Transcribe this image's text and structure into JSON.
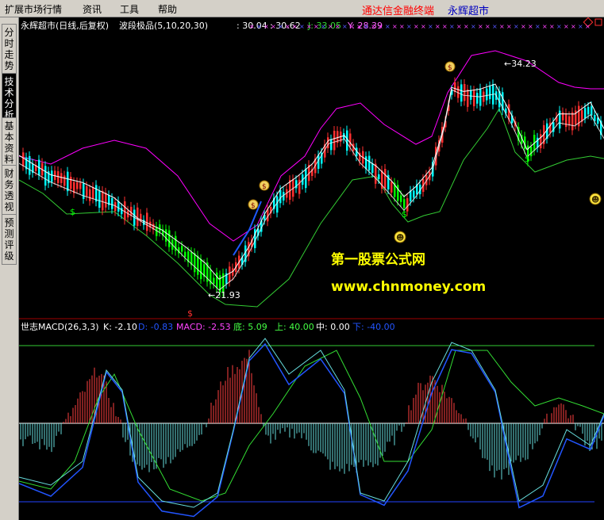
{
  "menu": {
    "items": [
      "扩展市场行情",
      "资讯",
      "工具",
      "帮助"
    ],
    "brand_left": "通达信金融终端",
    "brand_right": "永辉超市",
    "brand_left_color": "#ff0000",
    "brand_right_color": "#0000c0"
  },
  "sidebar": {
    "tabs": [
      {
        "label": "分时走势",
        "active": false
      },
      {
        "label": "技术分析",
        "active": true
      },
      {
        "label": "基本资料",
        "active": false
      },
      {
        "label": "财务透视",
        "active": false
      },
      {
        "label": "预测评级",
        "active": false
      }
    ]
  },
  "main_panel": {
    "title": "永辉超市(日线,后复权)",
    "indicator": "波段极品(5,10,20,30)",
    "readout_a": ": 30.04",
    "readout_b": ": 30.62",
    "readout_j": "J: 33.05",
    "readout_y": "Y: 28.39",
    "high_label": "34.23",
    "low_label": "21.93",
    "money_bag_glyph": "$",
    "smiley_glyph": "☻",
    "signal_glyph": "$",
    "watermark_title": "第一股票公式网",
    "watermark_url": "www.chnmoney.com"
  },
  "sub_panel": {
    "title": "世志MACD(26,3,3)",
    "k": "K: -2.10",
    "d": "D: -0.83",
    "macd": "MACD: -2.53",
    "di": "底: 5.09",
    "shang": "上: 40.00",
    "zhong": "中: 0.00",
    "xia": "下: -40.00"
  },
  "colors": {
    "up_candle": "#ff3030",
    "down_candle": "#00ffff",
    "signal_green": "#00ff00",
    "upper_band": "#ff00ff",
    "lower_band": "#33cc33",
    "white_line": "#ffffff",
    "blue_line": "#1e5aff",
    "macd_pos": "#ff4040",
    "macd_neg": "#66dddd",
    "watermark": "#ffff00"
  }
}
